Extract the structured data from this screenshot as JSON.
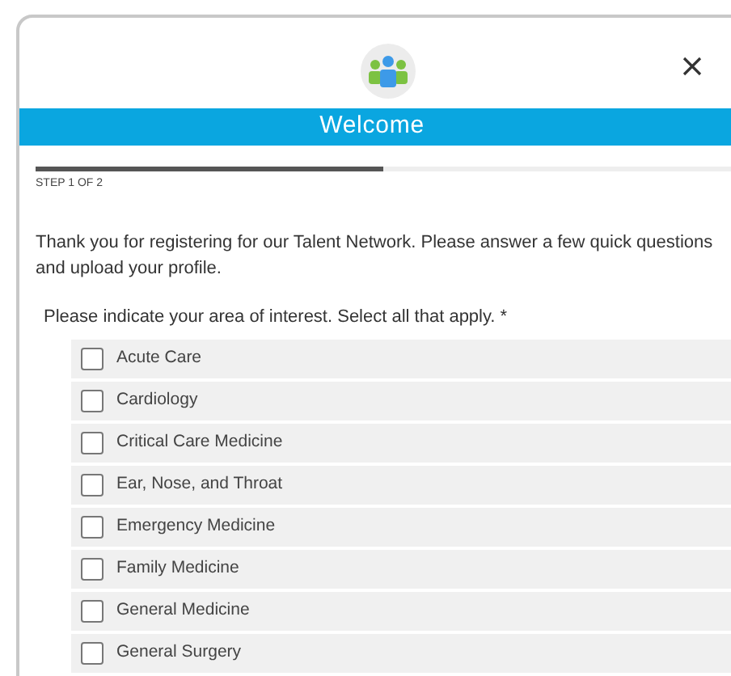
{
  "dialog": {
    "title": "Welcome"
  },
  "progress": {
    "level": 0.5,
    "label": "STEP 1 OF 2"
  },
  "intro": "Thank you for registering for our Talent Network.  Please answer a few quick questions and upload your profile.",
  "question": "Please indicate your area of interest. Select all that apply. *",
  "options": [
    {
      "label": "Acute Care",
      "checked": false
    },
    {
      "label": "Cardiology",
      "checked": false
    },
    {
      "label": "Critical Care Medicine",
      "checked": false
    },
    {
      "label": "Ear, Nose, and Throat",
      "checked": false
    },
    {
      "label": "Emergency Medicine",
      "checked": false
    },
    {
      "label": "Family Medicine",
      "checked": false
    },
    {
      "label": "General Medicine",
      "checked": false
    },
    {
      "label": "General Surgery",
      "checked": false
    }
  ]
}
